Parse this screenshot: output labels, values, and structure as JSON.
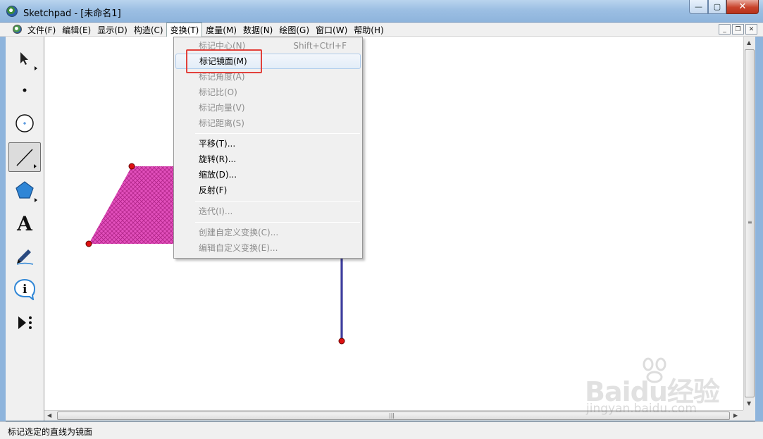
{
  "window": {
    "title": "Sketchpad  - [未命名1]",
    "controls": {
      "minimize": "—",
      "maximize": "▢",
      "close": "✕"
    }
  },
  "menubar": {
    "items": [
      {
        "label": "文件(F)",
        "active": false
      },
      {
        "label": "编辑(E)",
        "active": false
      },
      {
        "label": "显示(D)",
        "active": false
      },
      {
        "label": "构造(C)",
        "active": false
      },
      {
        "label": "变换(T)",
        "active": true
      },
      {
        "label": "度量(M)",
        "active": false
      },
      {
        "label": "数据(N)",
        "active": false
      },
      {
        "label": "绘图(G)",
        "active": false
      },
      {
        "label": "窗口(W)",
        "active": false
      },
      {
        "label": "帮助(H)",
        "active": false
      }
    ],
    "doc_controls": {
      "minimize": "_",
      "restore": "❐",
      "close": "✕"
    }
  },
  "toolbox": {
    "tools": [
      {
        "name": "arrow-select-tool-icon"
      },
      {
        "name": "point-tool-icon"
      },
      {
        "name": "compass-tool-icon"
      },
      {
        "name": "straightedge-tool-icon",
        "selected": true
      },
      {
        "name": "polygon-tool-icon"
      },
      {
        "name": "text-tool-icon",
        "glyph": "A"
      },
      {
        "name": "marker-tool-icon"
      },
      {
        "name": "information-tool-icon",
        "glyph": "i"
      },
      {
        "name": "custom-tool-icon"
      }
    ]
  },
  "transform_menu": {
    "items": [
      {
        "label": "标记中心(N)",
        "shortcut": "Shift+Ctrl+F",
        "disabled": true
      },
      {
        "label": "标记镜面(M)",
        "shortcut": "",
        "disabled": false,
        "highlighted": true
      },
      {
        "label": "标记角度(A)",
        "shortcut": "",
        "disabled": true
      },
      {
        "label": "标记比(O)",
        "shortcut": "",
        "disabled": true
      },
      {
        "label": "标记向量(V)",
        "shortcut": "",
        "disabled": true
      },
      {
        "label": "标记距离(S)",
        "shortcut": "",
        "disabled": true
      },
      {
        "label": "平移(T)...",
        "shortcut": "",
        "disabled": false
      },
      {
        "label": "旋转(R)...",
        "shortcut": "",
        "disabled": false
      },
      {
        "label": "缩放(D)...",
        "shortcut": "",
        "disabled": false
      },
      {
        "label": "反射(F)",
        "shortcut": "",
        "disabled": false
      },
      {
        "label": "迭代(I)...",
        "shortcut": "",
        "disabled": true
      },
      {
        "label": "创建自定义变换(C)...",
        "shortcut": "",
        "disabled": true
      },
      {
        "label": "编辑自定义变换(E)...",
        "shortcut": "",
        "disabled": true
      }
    ]
  },
  "canvas": {
    "polygon_fill_color": "#e040b0",
    "point_color": "#dd1111",
    "segment_color": "#1a1a80"
  },
  "statusbar": {
    "text": "标记选定的直线为镜面"
  },
  "watermark": {
    "logo": "Baidu经验",
    "url": "jingyan.baidu.com"
  },
  "colors": {
    "highlight_box": "#e2413b",
    "menu_highlight_border": "#aecbeb"
  }
}
